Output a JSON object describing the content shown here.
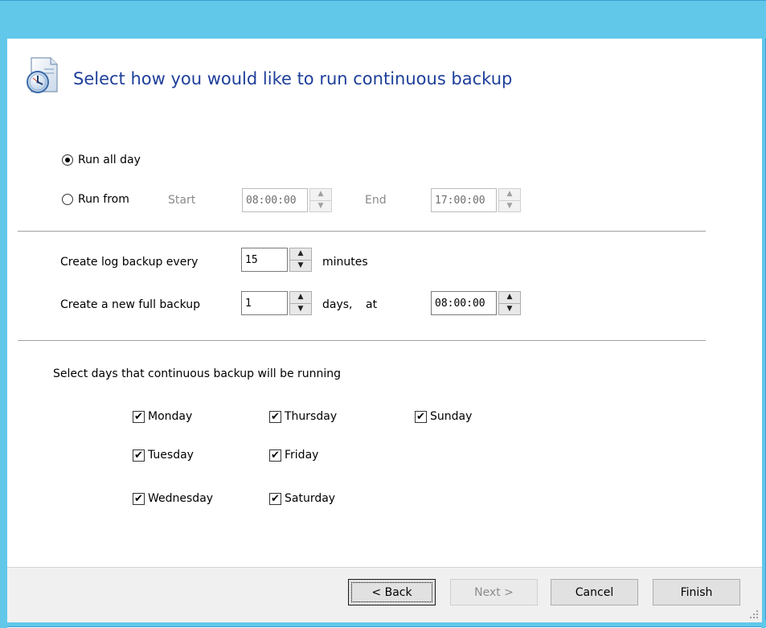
{
  "header": {
    "title": "Select how you would like to run continuous backup",
    "icon": "clock-document-icon"
  },
  "schedule": {
    "run_all_day_label": "Run all day",
    "run_all_day_checked": true,
    "run_from_label": "Run from",
    "run_from_checked": false,
    "start_label": "Start",
    "start_value": "08:00:00",
    "end_label": "End",
    "end_value": "17:00:00"
  },
  "log_backup": {
    "label": "Create log backup every",
    "value": "15",
    "unit": "minutes"
  },
  "full_backup": {
    "label": "Create a new full backup",
    "value": "1",
    "unit": "days,",
    "at_label": "at",
    "time_value": "08:00:00"
  },
  "days": {
    "heading": "Select days that continuous backup will be running",
    "items": [
      {
        "label": "Monday",
        "checked": true
      },
      {
        "label": "Tuesday",
        "checked": true
      },
      {
        "label": "Wednesday",
        "checked": true
      },
      {
        "label": "Thursday",
        "checked": true
      },
      {
        "label": "Friday",
        "checked": true
      },
      {
        "label": "Saturday",
        "checked": true
      },
      {
        "label": "Sunday",
        "checked": true
      }
    ]
  },
  "footer": {
    "back_label": "< Back",
    "next_label": "Next >",
    "cancel_label": "Cancel",
    "finish_label": "Finish"
  },
  "colors": {
    "title_bar": "#61c8ea",
    "title_text": "#1e3f9a",
    "footer_bg": "#f0f0f0"
  }
}
